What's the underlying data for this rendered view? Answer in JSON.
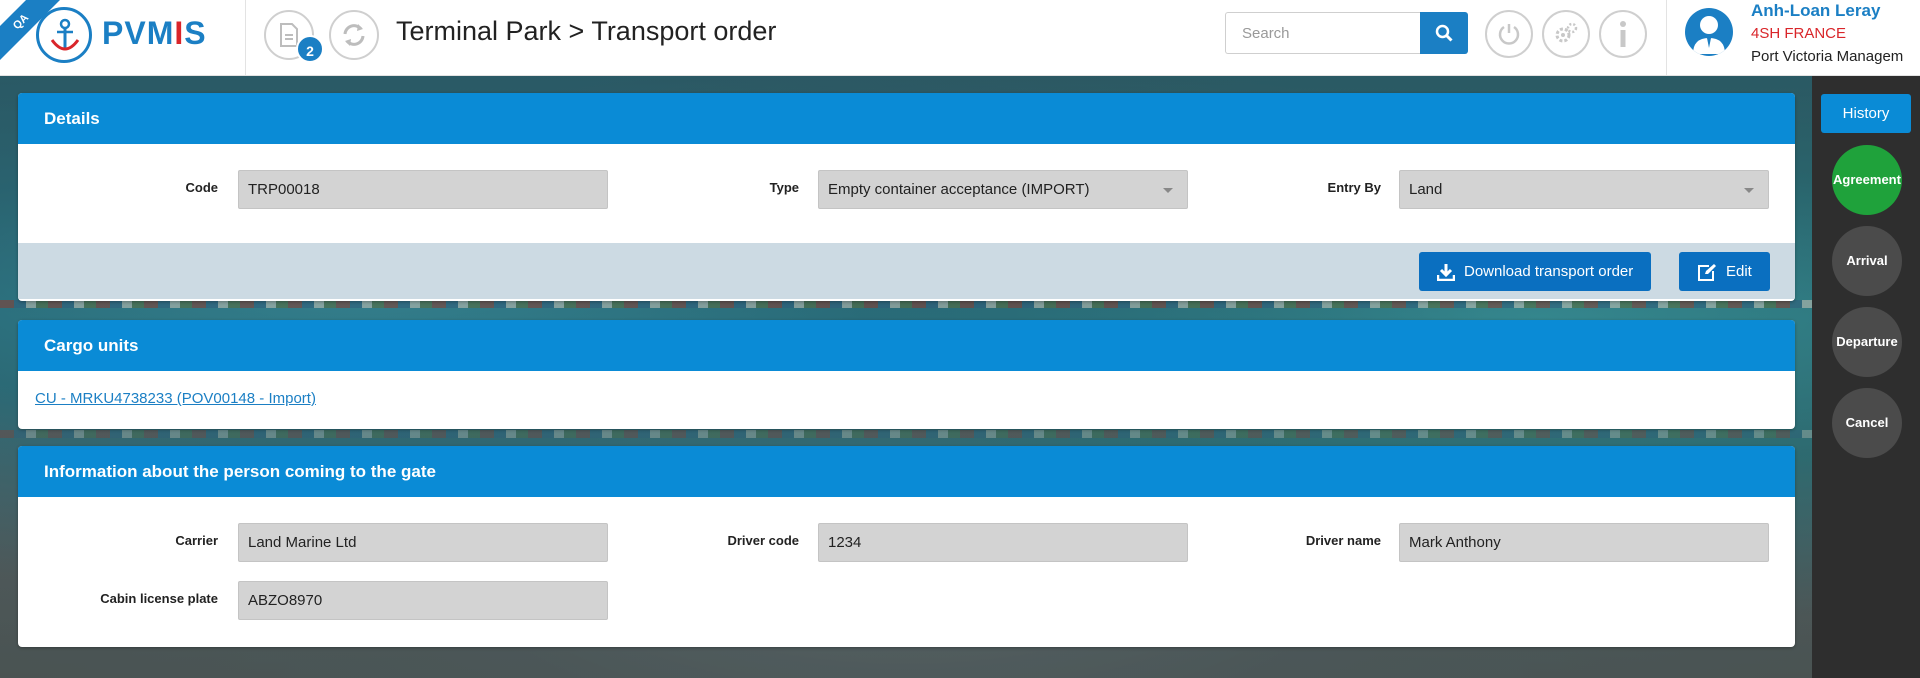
{
  "app": {
    "env_ribbon": "QA",
    "logo_text_a": "PVM",
    "logo_text_bar": "I",
    "logo_text_b": "S"
  },
  "header": {
    "notifications_count": "2",
    "title": "Terminal Park > Transport order",
    "search_placeholder": "Search"
  },
  "user": {
    "name": "Anh-Loan Leray",
    "company": "4SH FRANCE",
    "organization": "Port Victoria Managem"
  },
  "details": {
    "title": "Details",
    "code_label": "Code",
    "code_value": "TRP00018",
    "type_label": "Type",
    "type_value": "Empty container acceptance (IMPORT)",
    "entry_label": "Entry By",
    "entry_value": "Land",
    "download_label": "Download transport order",
    "edit_label": "Edit"
  },
  "cargo": {
    "title": "Cargo units",
    "link": "CU - MRKU4738233 (POV00148 - Import)"
  },
  "gate": {
    "title": "Information about the person coming to the gate",
    "carrier_label": "Carrier",
    "carrier_value": "Land Marine Ltd",
    "driver_code_label": "Driver code",
    "driver_code_value": "1234",
    "driver_name_label": "Driver name",
    "driver_name_value": "Mark Anthony",
    "plate_label": "Cabin license plate",
    "plate_value": "ABZO8970"
  },
  "rail": {
    "history": "History",
    "steps": [
      "Agreement",
      "Arrival",
      "Departure",
      "Cancel"
    ]
  },
  "colors": {
    "primary": "#1b7fc4",
    "panel_header": "#0a8bd6",
    "active_step": "#1fa23b",
    "accent_red": "#d9252a"
  }
}
